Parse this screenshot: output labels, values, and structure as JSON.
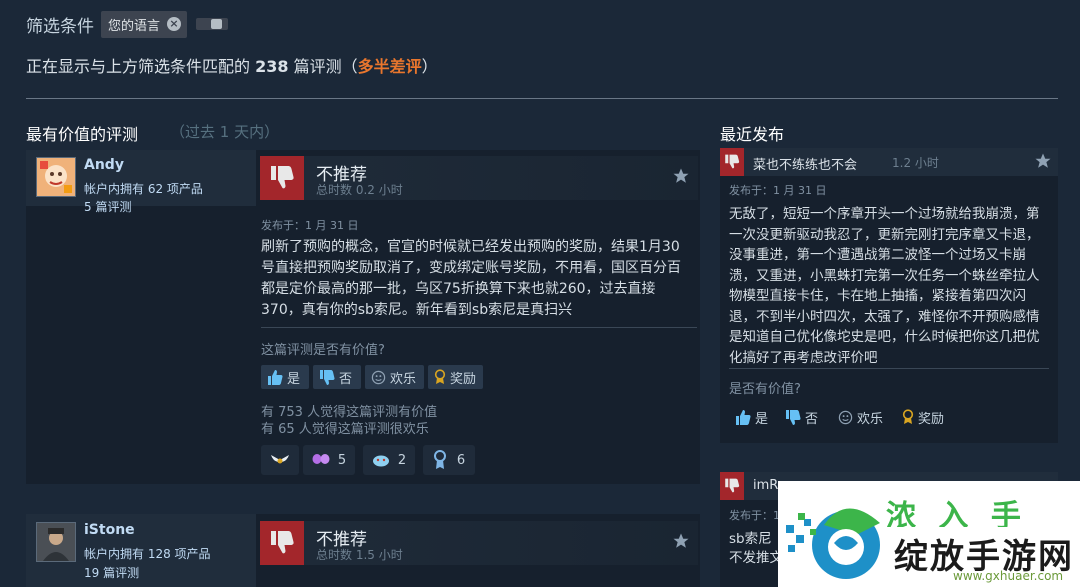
{
  "filters": {
    "label": "筛选条件",
    "chip_label": "您的语言"
  },
  "summary": {
    "prefix": "正在显示与上方筛选条件匹配的",
    "count": "238",
    "suffix_reviews": "篇评测（",
    "rating": "多半差评",
    "close_paren": "）"
  },
  "sections": {
    "helpful_title": "最有价值的评测",
    "helpful_sub": "（过去 1 天内）",
    "recent_title": "最近发布"
  },
  "reviews": [
    {
      "author": "Andy",
      "products": "帐户内拥有 62 项产品",
      "review_count": "5 篇评测",
      "verdict": "不推荐",
      "hours": "总时数 0.2 小时",
      "posted": "发布于：1 月 31 日",
      "text": "刷新了预购的概念，官宣的时候就已经发出预购的奖励，结果1月30号直接把预购奖励取消了，变成绑定账号奖励，不用看，国区百分百都是定价最高的那一批，乌区75折换算下来也就260，过去直接370，真有你的sb索尼。新年看到sb索尼是真扫兴",
      "helpful_question": "这篇评测是否有价值?",
      "btn_yes": "是",
      "btn_no": "否",
      "btn_funny": "欢乐",
      "btn_award": "奖励",
      "helpful_count": "有 753 人觉得这篇评测有价值",
      "funny_count": "有 65 人觉得这篇评测很欢乐",
      "awards": [
        {
          "icon": "wings-award-icon",
          "count": ""
        },
        {
          "icon": "butterfly-award-icon",
          "count": "5"
        },
        {
          "icon": "laugh-award-icon",
          "count": "2"
        },
        {
          "icon": "medal-award-icon",
          "count": "6"
        }
      ]
    },
    {
      "author": "iStone",
      "products": "帐户内拥有 128 项产品",
      "review_count": "19 篇评测",
      "verdict": "不推荐",
      "hours": "总时数 1.5 小时",
      "posted": ""
    }
  ],
  "recent": [
    {
      "author": "菜也不练练也不会",
      "hours": "1.2 小时",
      "posted": "发布于：1 月 31 日",
      "text": "无敌了，短短一个序章开头一个过场就给我崩溃，第一次没更新驱动我忍了，更新完刚打完序章又卡退，没事重进，第一个遭遇战第二波怪一个过场又卡崩溃，又重进，小黑蛛打完第一次任务一个蛛丝牵拉人物模型直接卡住，卡在地上抽搐，紧接着第四次闪退，不到半小时四次，太强了，难怪你不开预购感情是知道自己优化像坨史是吧，什么时候把你这几把优化搞好了再考虑改评价吧",
      "helpful_question": "是否有价值?",
      "btn_yes": "是",
      "btn_no": "否",
      "btn_funny": "欢乐",
      "btn_award": "奖励"
    },
    {
      "author": "imR",
      "posted": "发布于：1",
      "text_line1": "sb索尼",
      "text_line2": "不发推文"
    }
  ],
  "watermark": {
    "title": "绽放手游网",
    "url": "www.gxhuaer.com",
    "top_text": "浓 入 手 游"
  },
  "colors": {
    "background": "#1b2838",
    "negative": "#a3262b",
    "mixed_rating": "#e9762d",
    "award_gold": "#d9a521"
  }
}
